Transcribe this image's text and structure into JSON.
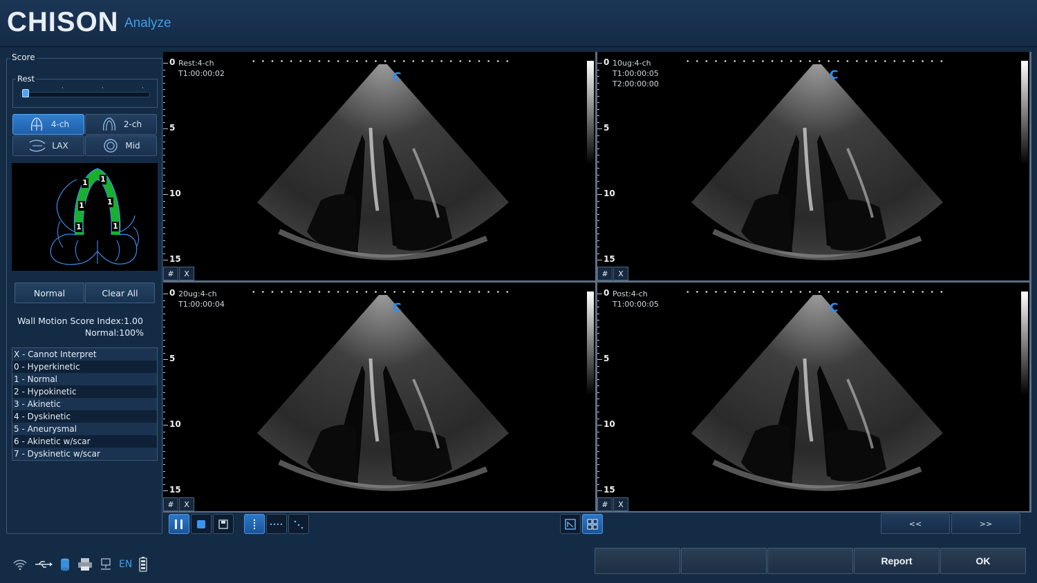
{
  "header": {
    "brand": "CHISON",
    "subtitle": "Analyze"
  },
  "score_panel": {
    "title": "Score",
    "stage_label": "Rest",
    "stage_slider_position": 0.0,
    "views": [
      {
        "label": "4-ch",
        "icon": "four-chamber-icon",
        "active": true
      },
      {
        "label": "2-ch",
        "icon": "two-chamber-icon",
        "active": false
      },
      {
        "label": "LAX",
        "icon": "long-axis-icon",
        "active": false
      },
      {
        "label": "Mid",
        "icon": "mid-short-axis-icon",
        "active": false
      }
    ],
    "segment_scores": [
      "1",
      "1",
      "1",
      "1",
      "1",
      "1"
    ],
    "segment_color": "#19b02a",
    "buttons": {
      "normal": "Normal",
      "clear_all": "Clear All"
    },
    "wms_index": "Wall Motion Score Index:1.00",
    "normal_pct": "Normal:100%",
    "score_legend": [
      "X - Cannot Interpret",
      "0 - Hyperkinetic",
      "1 - Normal",
      "2 - Hypokinetic",
      "3 - Akinetic",
      "4 - Dyskinetic",
      "5 - Aneurysmal",
      "6 - Akinetic w/scar",
      "7 - Dyskinetic w/scar"
    ]
  },
  "images": [
    {
      "label": "Rest:4-ch",
      "time1": "T1:00:00:02",
      "time2": "",
      "marker": "C"
    },
    {
      "label": "10ug:4-ch",
      "time1": "T1:00:00:05",
      "time2": "T2:00:00:00",
      "marker": "C"
    },
    {
      "label": "20ug:4-ch",
      "time1": "T1:00:00:04",
      "time2": "",
      "marker": "C"
    },
    {
      "label": "Post:4-ch",
      "time1": "T1:00:00:05",
      "time2": "",
      "marker": "C"
    }
  ],
  "depth_labels": [
    "0",
    "5",
    "10",
    "15"
  ],
  "image_buttons": {
    "grid": "#",
    "close": "X"
  },
  "nav": {
    "prev": "<<",
    "next": ">>"
  },
  "status": {
    "language": "EN"
  },
  "footer_buttons": [
    "",
    "",
    "",
    "Report",
    "OK"
  ],
  "colors": {
    "accent": "#2f8ef0",
    "background": "#142b45"
  }
}
